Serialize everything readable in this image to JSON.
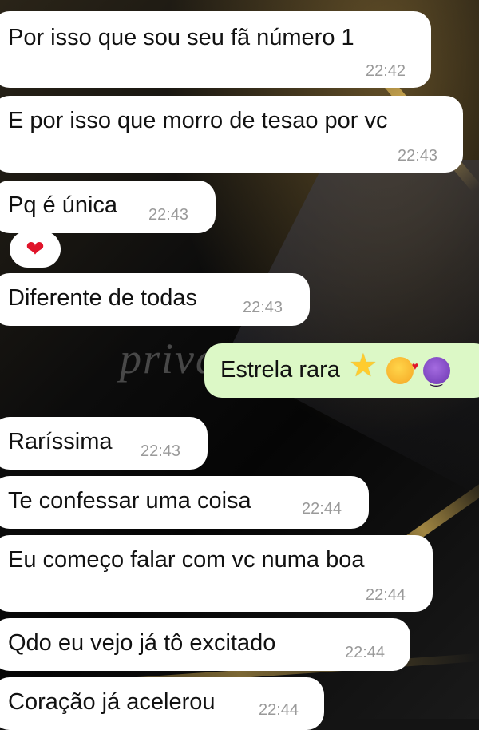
{
  "watermark": "privace",
  "messages": [
    {
      "text": "Por isso que sou seu fã número 1",
      "time": "22:42",
      "direction": "incoming"
    },
    {
      "text": "E por isso que morro de tesao por vc",
      "time": "22:43",
      "direction": "incoming"
    },
    {
      "text": "Pq é única",
      "time": "22:43",
      "direction": "incoming",
      "reaction": "heart-emoji"
    },
    {
      "text": "Diferente de todas",
      "time": "22:43",
      "direction": "incoming"
    },
    {
      "text": "Estrela rara",
      "direction": "outgoing",
      "emojis": [
        "star-emoji",
        "smiling-face-with-hearts-emoji",
        "smiling-devil-emoji"
      ]
    },
    {
      "text": "Raríssima",
      "time": "22:43",
      "direction": "incoming"
    },
    {
      "text": "Te confessar uma coisa",
      "time": "22:44",
      "direction": "incoming"
    },
    {
      "text": "Eu começo falar com vc numa boa",
      "time": "22:44",
      "direction": "incoming"
    },
    {
      "text": "Qdo eu vejo já tô excitado",
      "time": "22:44",
      "direction": "incoming"
    },
    {
      "text": "Coração já acelerou",
      "time": "22:44",
      "direction": "incoming"
    }
  ],
  "colors": {
    "incoming_bubble": "#ffffff",
    "outgoing_bubble": "#dcf8c6",
    "timestamp": "#9a9a9a"
  }
}
